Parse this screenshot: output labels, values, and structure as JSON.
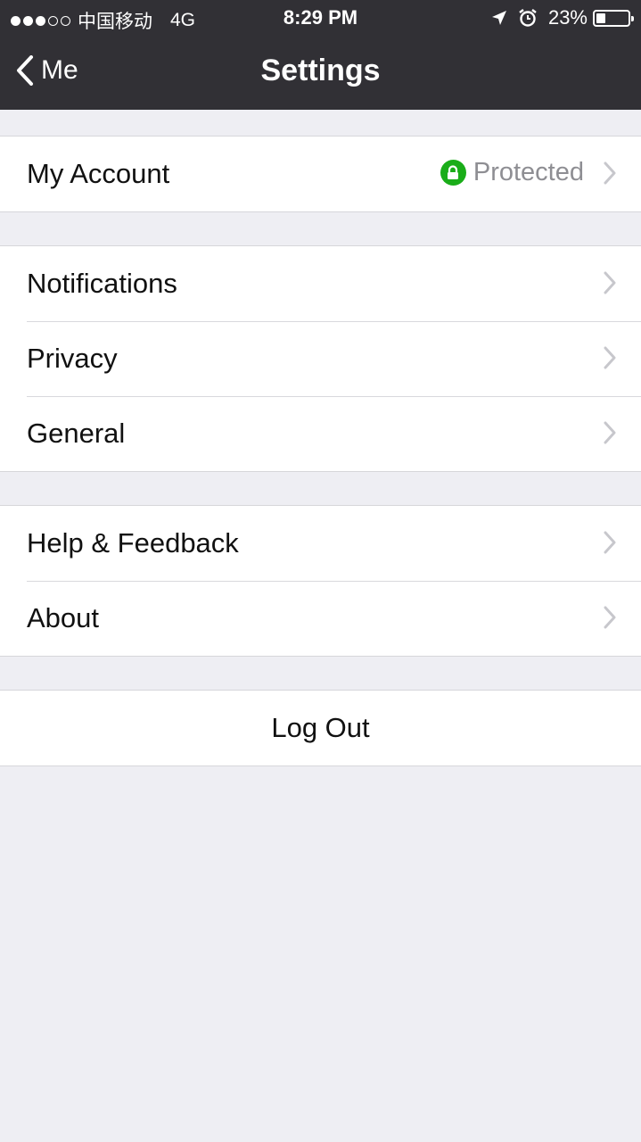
{
  "status_bar": {
    "carrier": "中国移动",
    "network": "4G",
    "time": "8:29 PM",
    "battery": "23%",
    "battery_level": 0.23,
    "signal_strength": 3,
    "signal_max": 5,
    "icons": [
      "location-arrow-icon",
      "alarm-icon",
      "battery-icon"
    ]
  },
  "nav": {
    "back_label": "Me",
    "title": "Settings"
  },
  "groups": {
    "account": {
      "label": "My Account",
      "status": "Protected",
      "status_color": "#1aad19"
    },
    "main": {
      "items": [
        {
          "label": "Notifications"
        },
        {
          "label": "Privacy"
        },
        {
          "label": "General"
        }
      ]
    },
    "support": {
      "items": [
        {
          "label": "Help & Feedback"
        },
        {
          "label": "About"
        }
      ]
    },
    "logout": {
      "label": "Log Out"
    }
  },
  "colors": {
    "bar": "#313035",
    "background": "#eeeef3",
    "chevron": "#c7c7cc"
  }
}
